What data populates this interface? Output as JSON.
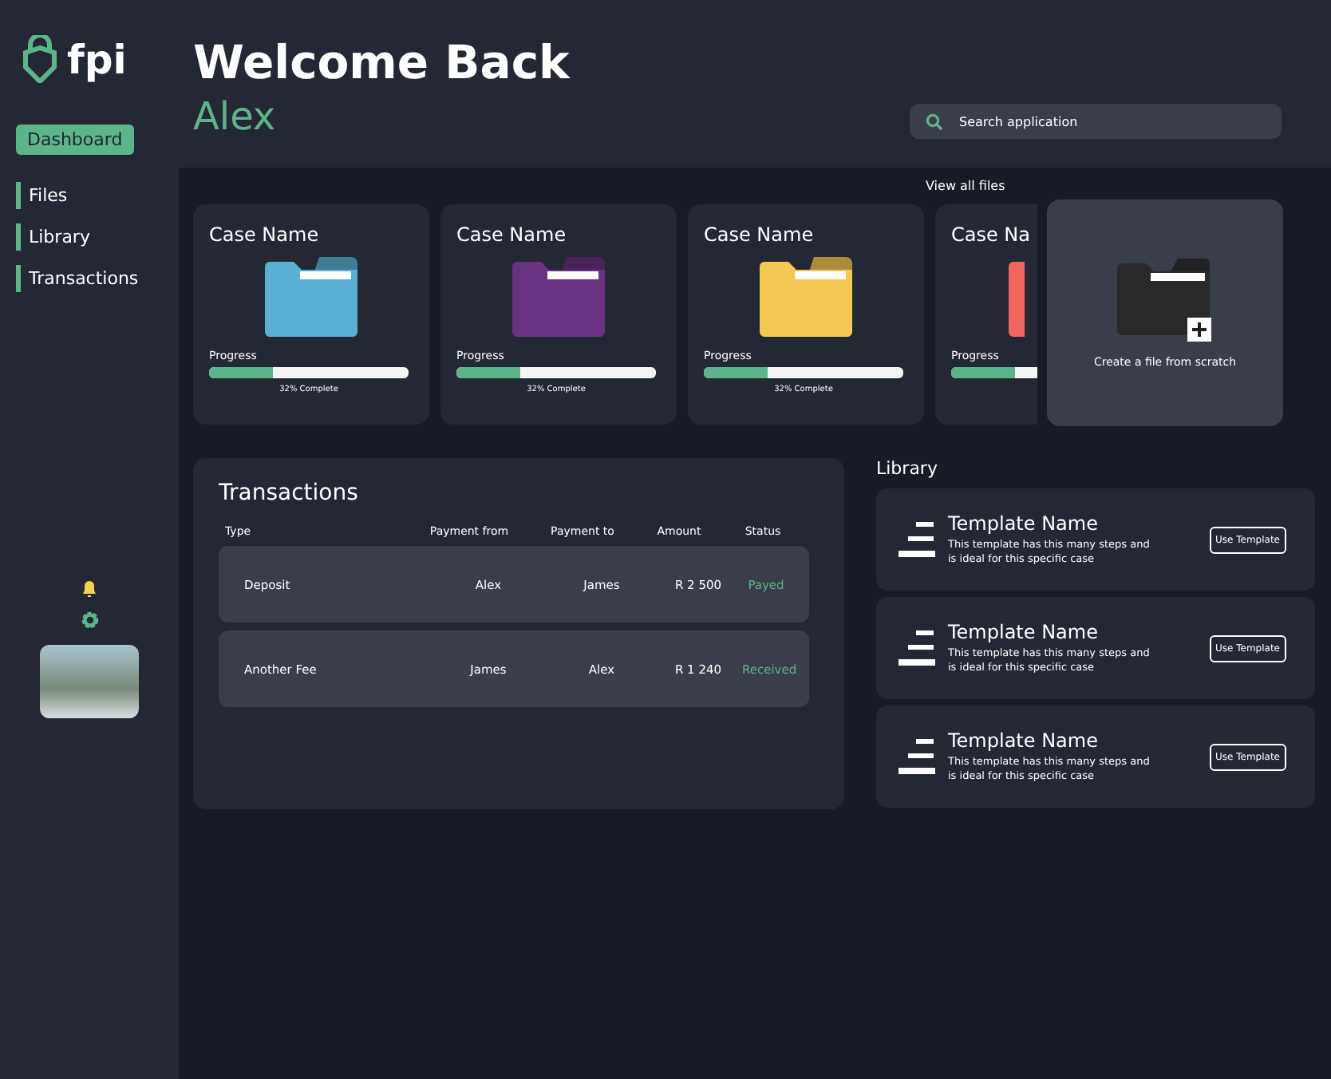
{
  "brand": "fpi",
  "nav": [
    {
      "label": "Dashboard",
      "selected": true
    },
    {
      "label": "Files",
      "selected": false
    },
    {
      "label": "Library",
      "selected": false
    },
    {
      "label": "Transactions",
      "selected": false
    }
  ],
  "greeting": "Welcome Back",
  "user": "Alex",
  "search": {
    "placeholder": "Search application"
  },
  "view_all": "View all files",
  "cases": [
    {
      "name": "Case Name",
      "color": "#5ab0d4",
      "progress_label": "Progress",
      "level": 0.32,
      "caption": "32% Complete"
    },
    {
      "name": "Case Name",
      "color": "#6a3282",
      "progress_label": "Progress",
      "level": 0.32,
      "caption": "32% Complete"
    },
    {
      "name": "Case Name",
      "color": "#f4c853",
      "progress_label": "Progress",
      "level": 0.32,
      "caption": "32% Complete"
    },
    {
      "name": "Case Na",
      "color": "#f06560",
      "progress_label": "Progress",
      "level": 0.32
    }
  ],
  "create_file": {
    "label": "Create a file from scratch"
  },
  "transactions": {
    "title": "Transactions",
    "columns": [
      "Type",
      "Payment from",
      "Payment to",
      "Amount",
      "Status"
    ],
    "rows": [
      {
        "cells": [
          "Deposit",
          "Alex",
          "James",
          "R 2 500"
        ],
        "status": "Payed"
      },
      {
        "cells": [
          "Another Fee",
          "James",
          "Alex",
          "R 1 240"
        ],
        "status": "Received"
      }
    ]
  },
  "library": {
    "title": "Library",
    "templates": [
      {
        "name": "Template Name",
        "description": "This template has this many steps and is ideal for this specific case",
        "button": "Use Template"
      },
      {
        "name": "Template Name",
        "description": "This template has this many steps and is ideal for this specific case",
        "button": "Use Template"
      },
      {
        "name": "Template Name",
        "description": "This template has this many steps and is ideal for this specific case",
        "button": "Use Template"
      }
    ]
  }
}
